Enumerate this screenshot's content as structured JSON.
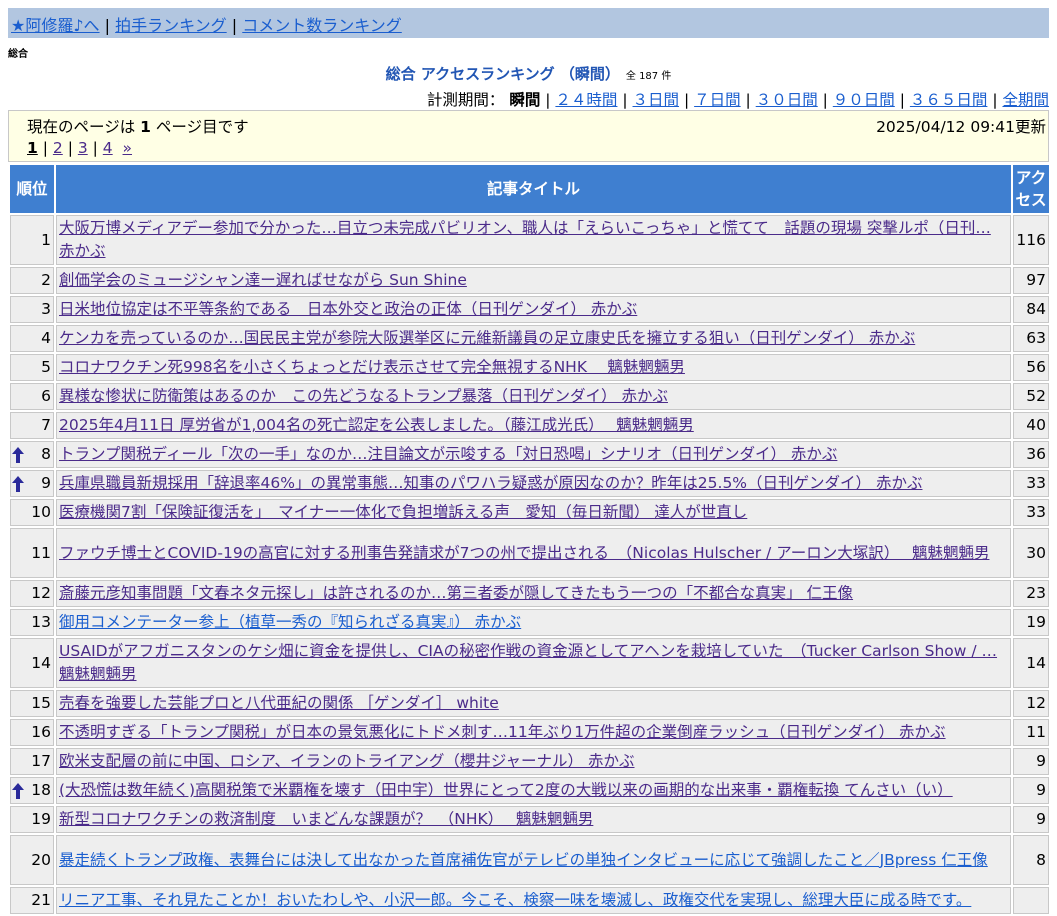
{
  "topbar": {
    "home_link": "★阿修羅♪へ",
    "sep": "|",
    "applause_link": "拍手ランキング",
    "comment_link": "コメント数ランキング"
  },
  "category_label": "総合",
  "heading": {
    "title": "総合 アクセスランキング （瞬間）",
    "count": "全 187 件"
  },
  "period": {
    "label": "計測期間：",
    "current": "瞬間",
    "links": [
      "２４時間",
      "３日間",
      "７日間",
      "３０日間",
      "９０日間",
      "３６５日間",
      "全期間"
    ]
  },
  "info": {
    "current_page_prefix": "現在のページは",
    "current_page": "1",
    "current_page_suffix": "ページ目です",
    "updated": "2025/04/12 09:41更新"
  },
  "pager": {
    "current": "1",
    "pages": [
      "2",
      "3",
      "4"
    ],
    "next": "»"
  },
  "table": {
    "headers": {
      "rank": "順位",
      "title": "記事タイトル",
      "access": "アクセス"
    },
    "rows": [
      {
        "rank": "1",
        "title": "大阪万博メディアデー参加で分かった…目立つ未完成パビリオン、職人は「えらいこっちゃ」と慌てて　話題の現場 突撃ルポ（日刊… 赤かぶ",
        "access": "116",
        "up": false,
        "unvisited": false
      },
      {
        "rank": "2",
        "title": "創価学会のミュージシャン達ー遅ればせながら Sun Shine",
        "access": "97",
        "up": false,
        "unvisited": false
      },
      {
        "rank": "3",
        "title": "日米地位協定は不平等条約である　日本外交と政治の正体（日刊ゲンダイ）  赤かぶ",
        "access": "84",
        "up": false,
        "unvisited": false
      },
      {
        "rank": "4",
        "title": "ケンカを売っているのか…国民民主党が参院大阪選挙区に元維新議員の足立康史氏を擁立する狙い（日刊ゲンダイ）  赤かぶ",
        "access": "63",
        "up": false,
        "unvisited": false
      },
      {
        "rank": "5",
        "title": "コロナワクチン死998名を小さくちょっとだけ表示させて完全無視するNHK　 魑魅魍魎男",
        "access": "56",
        "up": false,
        "unvisited": false
      },
      {
        "rank": "6",
        "title": "異様な惨状に防衛策はあるのか　この先どうなるトランプ暴落（日刊ゲンダイ）  赤かぶ",
        "access": "52",
        "up": false,
        "unvisited": false
      },
      {
        "rank": "7",
        "title": "2025年4月11日 厚労省が1,004名の死亡認定を公表しました。（藤江成光氏）　 魑魅魍魎男",
        "access": "40",
        "up": false,
        "unvisited": false
      },
      {
        "rank": "8",
        "title": "トランプ関税ディール「次の一手」なのか…注目論文が示唆する「対日恐喝」シナリオ（日刊ゲンダイ）  赤かぶ",
        "access": "36",
        "up": true,
        "unvisited": false
      },
      {
        "rank": "9",
        "title": "兵庫県職員新規採用「辞退率46%」の異常事態…知事のパワハラ疑惑が原因なのか？昨年は25.5%（日刊ゲンダイ）  赤かぶ",
        "access": "33",
        "up": true,
        "unvisited": false
      },
      {
        "rank": "10",
        "title": "医療機関7割「保険証復活を」　マイナー一体化で負担増訴える声　愛知（毎日新聞） 達人が世直し",
        "access": "33",
        "up": false,
        "unvisited": false
      },
      {
        "rank": "11",
        "title": "ファウチ博士とCOVID-19の高官に対する刑事告発請求が7つの州で提出される　（Nicolas Hulscher / アーロン大塚訳）　 魑魅魍魎男",
        "access": "30",
        "up": false,
        "unvisited": false
      },
      {
        "rank": "12",
        "title": "斎藤元彦知事問題「文春ネタ元探し」は許されるのか…第三者委が隠してきたもう一つの「不都合な真実」 仁王像",
        "access": "23",
        "up": false,
        "unvisited": false
      },
      {
        "rank": "13",
        "title": "御用コメンテーター参上（植草一秀の『知られざる真実』）  赤かぶ",
        "access": "19",
        "up": false,
        "unvisited": true
      },
      {
        "rank": "14",
        "title": "USAIDがアフガニスタンのケシ畑に資金を提供し、CIAの秘密作戦の資金源としてアヘンを栽培していた　（Tucker Carlson Show / … 魑魅魍魎男",
        "access": "14",
        "up": false,
        "unvisited": false
      },
      {
        "rank": "15",
        "title": "売春を強要した芸能プロと八代亜紀の関係 ［ゲンダイ］ white",
        "access": "12",
        "up": false,
        "unvisited": false
      },
      {
        "rank": "16",
        "title": "不透明すぎる「トランプ関税」が日本の景気悪化にトドメ刺す…11年ぶり1万件超の企業倒産ラッシュ（日刊ゲンダイ）  赤かぶ",
        "access": "11",
        "up": false,
        "unvisited": false
      },
      {
        "rank": "17",
        "title": "欧米支配層の前に中国、ロシア、イランのトライアング（櫻井ジャーナル）  赤かぶ",
        "access": "9",
        "up": false,
        "unvisited": false
      },
      {
        "rank": "18",
        "title": "(大恐慌は数年続く)高関税策で米覇権を壊す（田中宇）世界にとって2度の大戦以来の画期的な出来事・覇権転換 てんさい（い）",
        "access": "9",
        "up": true,
        "unvisited": false
      },
      {
        "rank": "19",
        "title": "新型コロナワクチンの救済制度　いまどんな課題が？　（NHK）　 魑魅魍魎男",
        "access": "9",
        "up": false,
        "unvisited": false
      },
      {
        "rank": "20",
        "title": "暴走続くトランプ政権、表舞台には決して出なかった首席補佐官がテレビの単独インタビューに応じて強調したこと／JBpress 仁王像",
        "access": "8",
        "up": false,
        "unvisited": true
      },
      {
        "rank": "21",
        "title": "リニア工事、それ見たことか！おいたわしや、小沢一郎。今こそ、検察一味を壊滅し、政権交代を実現し、総理大臣に成る時です。",
        "access": "",
        "up": false,
        "unvisited": true
      }
    ]
  },
  "colors": {
    "header_bg": "#3f7fd0",
    "topbar_bg": "#b2c6e0",
    "infobox_bg": "#ffffe5",
    "row_bg": "#eeeeee",
    "arrow": "#2a2a9a"
  },
  "icons": {
    "rank_up": "arrow-up-icon"
  }
}
